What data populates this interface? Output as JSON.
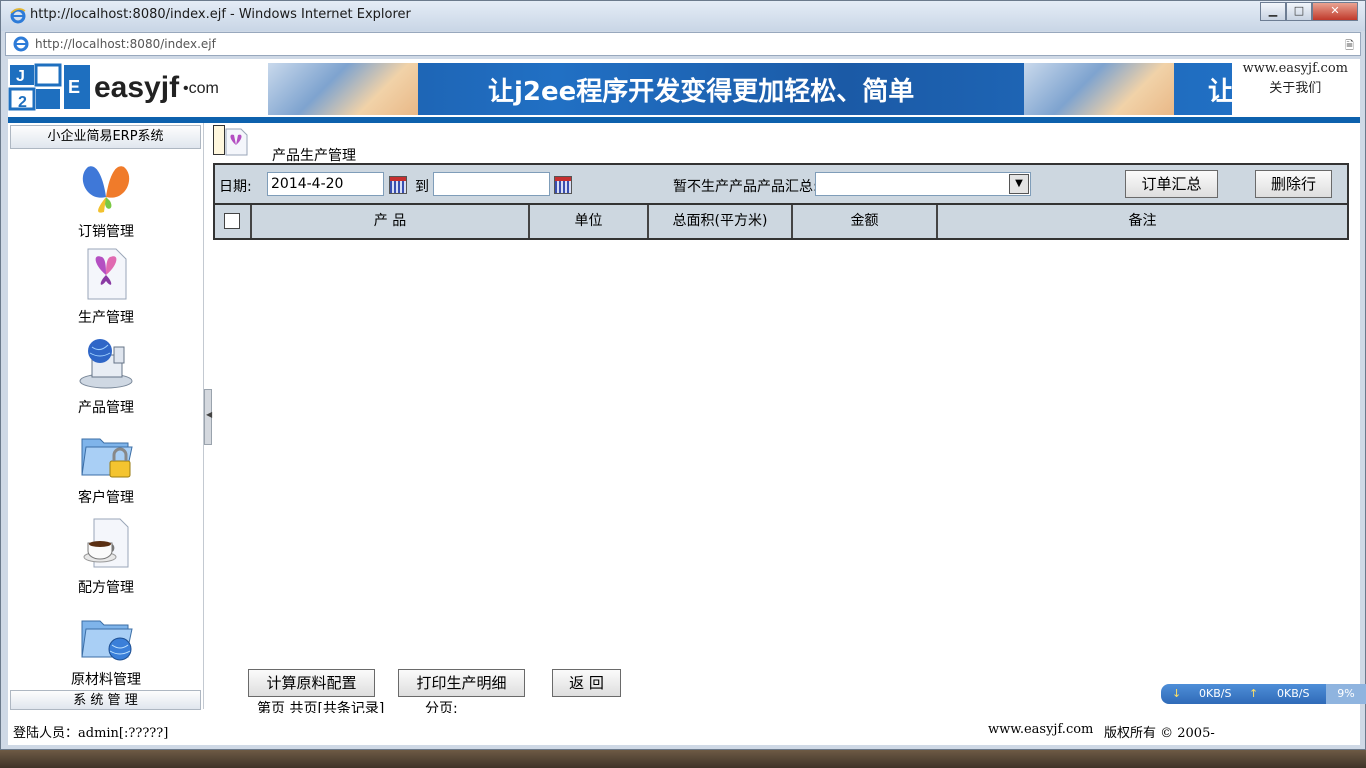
{
  "window": {
    "title": "http://localhost:8080/index.ejf - Windows Internet Explorer",
    "url": "http://localhost:8080/index.ejf"
  },
  "header": {
    "logo_text": "easyjf",
    "logo_dot": "•com",
    "logo_mark": "J2EE",
    "banner": "让j2ee程序开发变得更加轻松、简单",
    "banner_tail": "让",
    "site_url": "www.easyjf.com",
    "about": "关于我们"
  },
  "sidebar": {
    "title": "小企业简易ERP系统",
    "footer": "系 统 管 理",
    "items": [
      {
        "label": "订销管理",
        "icon": "butterfly-icon"
      },
      {
        "label": "生产管理",
        "icon": "document-butterfly-icon"
      },
      {
        "label": "产品管理",
        "icon": "globe-computer-icon"
      },
      {
        "label": "客户管理",
        "icon": "locked-folder-icon"
      },
      {
        "label": "配方管理",
        "icon": "coffee-document-icon"
      },
      {
        "label": "原材料管理",
        "icon": "globe-folder-icon"
      }
    ]
  },
  "main": {
    "title": "产品生产管理",
    "filter": {
      "date_label": "日期:",
      "date_from": "2014-4-20",
      "to_label": "到",
      "date_to": "",
      "summary_label": "暂不生产产品产品汇总:",
      "summary_value": "",
      "order_summary_btn": "订单汇总",
      "delete_row_btn": "删除行"
    },
    "table": {
      "columns": [
        "产 品",
        "单位",
        "总面积(平方米)",
        "金额",
        "备注"
      ]
    },
    "pager": {
      "info": "第页 共页[共条记录]",
      "paging": "分页:"
    },
    "actions": {
      "calc": "计算原料配置",
      "print": "打印生产明细",
      "back": "返 回"
    }
  },
  "status": {
    "user": "登陆人员：admin[:?????]",
    "site": "www.easyjf.com",
    "copyright": "版权所有 © 2005-"
  },
  "netmeter": {
    "down": "0KB/S",
    "up": "0KB/S",
    "percent": "9%"
  },
  "colors": {
    "accent_blue": "#0d61ad",
    "banner": "#1b5aa6",
    "toolbar_bg": "#cdd7e0"
  }
}
